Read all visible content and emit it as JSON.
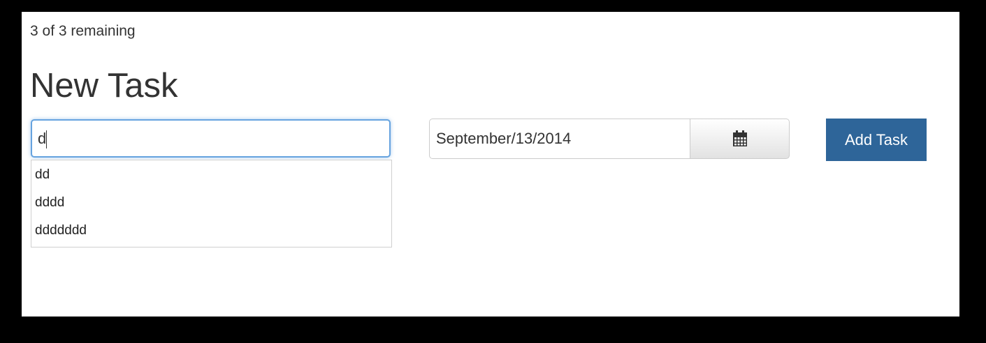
{
  "status": {
    "remaining_text": "3 of 3 remaining"
  },
  "form": {
    "heading": "New Task",
    "task_input": {
      "value": "d"
    },
    "suggestions": [
      "dd",
      "dddd",
      "ddddddd"
    ],
    "date_input": {
      "value": "September/13/2014"
    },
    "calendar_icon": "calendar-icon",
    "add_button_label": "Add Task"
  },
  "colors": {
    "focus_border": "#66a3df",
    "primary_button": "#2e6599"
  }
}
